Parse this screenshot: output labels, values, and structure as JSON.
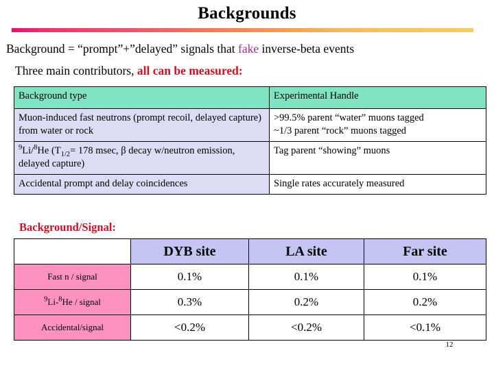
{
  "slide": {
    "title": "Backgrounds",
    "page_number": "12",
    "accent_gradient_start": "#ec0f6e",
    "accent_gradient_end": "#fccb63",
    "highlight_color": "#9b2d8f",
    "emphasis_color": "#cc1122"
  },
  "bullets": {
    "line1_a": "Background = “prompt”+”delayed” signals that ",
    "line1_highlight": "fake",
    "line1_b": " inverse-beta events",
    "line2_a": "Three main contributors, ",
    "line2_emphasis": "all can be measured:"
  },
  "background_table": {
    "header": [
      "Background type",
      "Experimental Handle"
    ],
    "header_bg": "#7fe3c4",
    "key_bg": "#dcdcf5",
    "rows": [
      {
        "type_line1": "Muon-induced fast neutrons (prompt recoil,",
        "type_line2": "delayed capture) from water or rock",
        "handle_line1": ">99.5% parent “water” muons tagged",
        "handle_line2": "~1/3 parent “rock” muons tagged"
      },
      {
        "type_pre": "Li/",
        "type_sup1": "9",
        "type_sup2": "8",
        "type_mid": "He (T",
        "type_sub": "1/2",
        "type_post": "= 178 msec, β decay w/neutron",
        "type_line2": "emission, delayed capture)",
        "handle_line1": "Tag parent “showing” muons",
        "handle_line2": ""
      },
      {
        "type_line1": "Accidental prompt and delay coincidences",
        "type_line2": "",
        "handle_line1": "Single rates accurately measured",
        "handle_line2": ""
      }
    ]
  },
  "ratio_section": {
    "label": "Background/Signal:",
    "header_bg": "#c3c6f2",
    "rowlabel_bg": "#fd92c0",
    "columns": [
      "",
      "DYB site",
      "LA site",
      "Far site"
    ],
    "rows": [
      {
        "label": "Fast n / signal",
        "values": [
          "0.1%",
          "0.1%",
          "0.1%"
        ]
      },
      {
        "label_sup1": "9",
        "label_mid": "Li-",
        "label_sup2": "8",
        "label_post": "He / signal",
        "values": [
          "0.3%",
          "0.2%",
          "0.2%"
        ]
      },
      {
        "label": "Accidental/signal",
        "values": [
          "<0.2%",
          "<0.2%",
          "<0.1%"
        ]
      }
    ]
  }
}
